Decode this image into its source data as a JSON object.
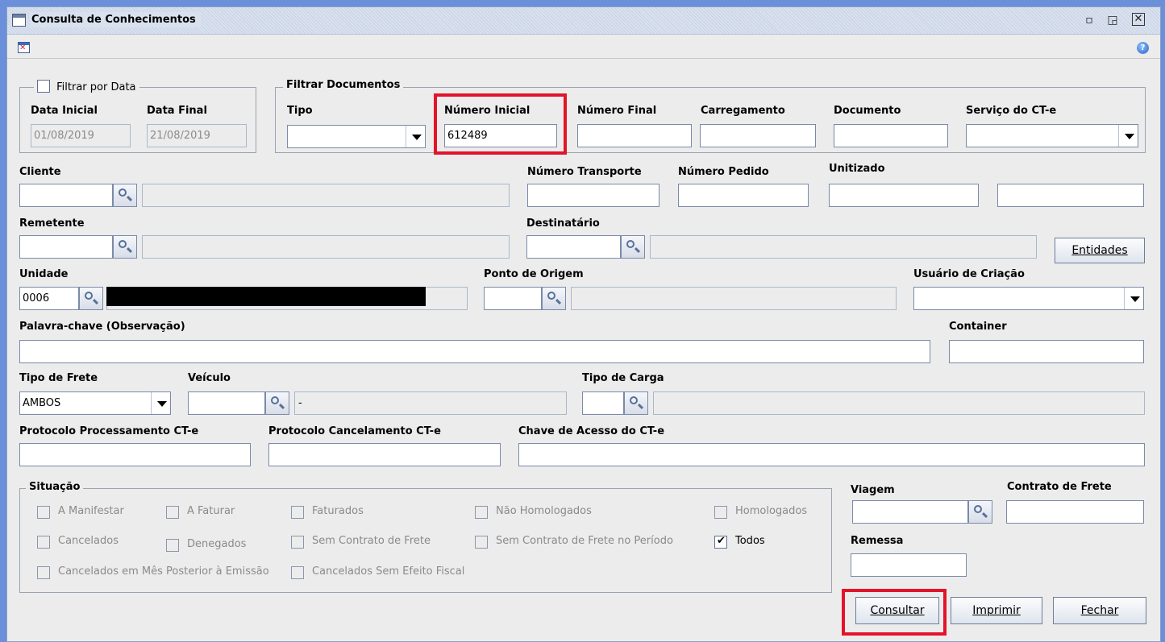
{
  "window": {
    "title": "Consulta de Conhecimentos",
    "controls": [
      "minimize-icon",
      "maximize-icon",
      "close-icon"
    ]
  },
  "toolbar": {
    "left_icon": "close-document-icon",
    "right_icon": "help-icon"
  },
  "filter_date": {
    "title": "Filtrar por Data",
    "checked": false,
    "start_label": "Data Inicial",
    "start_value": "01/08/2019",
    "end_label": "Data Final",
    "end_value": "21/08/2019"
  },
  "filter_docs": {
    "title": "Filtrar Documentos",
    "tipo_label": "Tipo",
    "tipo_value": "",
    "numero_inicial_label": "Número Inicial",
    "numero_inicial_value": "612489",
    "numero_final_label": "Número Final",
    "numero_final_value": "",
    "carregamento_label": "Carregamento",
    "documento_label": "Documento",
    "servico_label": "Serviço do CT-e",
    "servico_value": ""
  },
  "fields": {
    "cliente": "Cliente",
    "numero_transporte": "Número Transporte",
    "numero_pedido": "Número Pedido",
    "unitizado": "Unitizado",
    "remetente": "Remetente",
    "destinatario": "Destinatário",
    "entidades_button": "Entidades",
    "unidade": "Unidade",
    "unidade_value": "0006",
    "ponto_origem": "Ponto de Origem",
    "usuario_criacao": "Usuário de Criação",
    "palavra_chave": "Palavra-chave (Observação)",
    "container": "Container",
    "tipo_frete": "Tipo de Frete",
    "tipo_frete_value": "AMBOS",
    "veiculo": "Veículo",
    "veiculo_desc": "-",
    "tipo_carga": "Tipo de Carga",
    "protocolo_processamento": "Protocolo Processamento CT-e",
    "protocolo_cancelamento": "Protocolo Cancelamento CT-e",
    "chave_acesso": "Chave de Acesso do CT-e"
  },
  "situacao": {
    "title": "Situação",
    "items": [
      {
        "label": "A Manifestar",
        "checked": false,
        "enabled": false
      },
      {
        "label": "A Faturar",
        "checked": false,
        "enabled": false
      },
      {
        "label": "Faturados",
        "checked": false,
        "enabled": false
      },
      {
        "label": "Não Homologados",
        "checked": false,
        "enabled": false
      },
      {
        "label": "Homologados",
        "checked": false,
        "enabled": false
      },
      {
        "label": "Cancelados",
        "checked": false,
        "enabled": false
      },
      {
        "label": "Denegados",
        "checked": false,
        "enabled": false
      },
      {
        "label": "Sem Contrato de Frete",
        "checked": false,
        "enabled": false
      },
      {
        "label": "Sem Contrato de Frete no Período",
        "checked": false,
        "enabled": false
      },
      {
        "label": "Todos",
        "checked": true,
        "enabled": true
      },
      {
        "label": "Cancelados em Mês Posterior à Emissão",
        "checked": false,
        "enabled": false
      },
      {
        "label": "Cancelados Sem Efeito Fiscal",
        "checked": false,
        "enabled": false
      }
    ]
  },
  "right_panel": {
    "viagem": "Viagem",
    "contrato_frete": "Contrato de Frete",
    "remessa": "Remessa"
  },
  "buttons": {
    "consultar": "Consultar",
    "imprimir": "Imprimir",
    "fechar": "Fechar"
  },
  "colors": {
    "highlight_box": "#e3142a",
    "window_border": "#6b8fd8"
  }
}
